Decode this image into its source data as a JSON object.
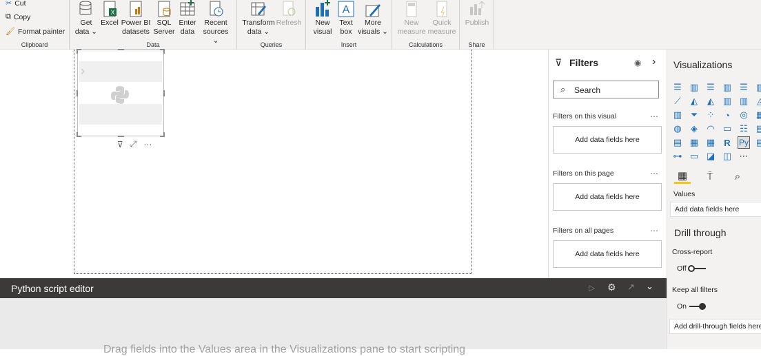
{
  "ribbon": {
    "clipboard": {
      "cut": "Cut",
      "copy": "Copy",
      "format_painter": "Format painter",
      "label": "Clipboard"
    },
    "data": {
      "label": "Data",
      "buttons": [
        {
          "l1": "Get",
          "l2": "data ⌄"
        },
        {
          "l1": "Excel",
          "l2": ""
        },
        {
          "l1": "Power BI",
          "l2": "datasets"
        },
        {
          "l1": "SQL",
          "l2": "Server"
        },
        {
          "l1": "Enter",
          "l2": "data"
        },
        {
          "l1": "Recent",
          "l2": "sources ⌄"
        }
      ]
    },
    "queries": {
      "label": "Queries",
      "transform_l1": "Transform",
      "transform_l2": "data ⌄",
      "refresh": "Refresh"
    },
    "insert": {
      "label": "Insert",
      "new_visual_l1": "New",
      "new_visual_l2": "visual",
      "text_box_l1": "Text",
      "text_box_l2": "box",
      "more_l1": "More",
      "more_l2": "visuals ⌄"
    },
    "calculations": {
      "label": "Calculations",
      "new_measure_l1": "New",
      "new_measure_l2": "measure",
      "quick_l1": "Quick",
      "quick_l2": "measure"
    },
    "share": {
      "label": "Share",
      "publish": "Publish"
    }
  },
  "editor": {
    "title": "Python script editor",
    "hint": "Drag fields into the Values area in the Visualizations pane to start scripting"
  },
  "filters": {
    "title": "Filters",
    "search_placeholder": "Search",
    "sections": [
      {
        "label": "Filters on this visual",
        "drop": "Add data fields here"
      },
      {
        "label": "Filters on this page",
        "drop": "Add data fields here"
      },
      {
        "label": "Filters on all pages",
        "drop": "Add data fields here"
      }
    ]
  },
  "visualizations": {
    "title": "Visualizations",
    "values_label": "Values",
    "values_field": "Add data fields here",
    "drill_title": "Drill through",
    "cross_report": "Cross-report",
    "cross_report_state": "Off",
    "keep_filters": "Keep all filters",
    "keep_filters_state": "On",
    "drill_field": "Add drill-through fields here",
    "r_icon": "R",
    "py_icon": "Py"
  },
  "colors": {
    "accent": "#f2c811",
    "editor_bar": "#3b3a39",
    "viz_icon": "#1f6fb6"
  }
}
